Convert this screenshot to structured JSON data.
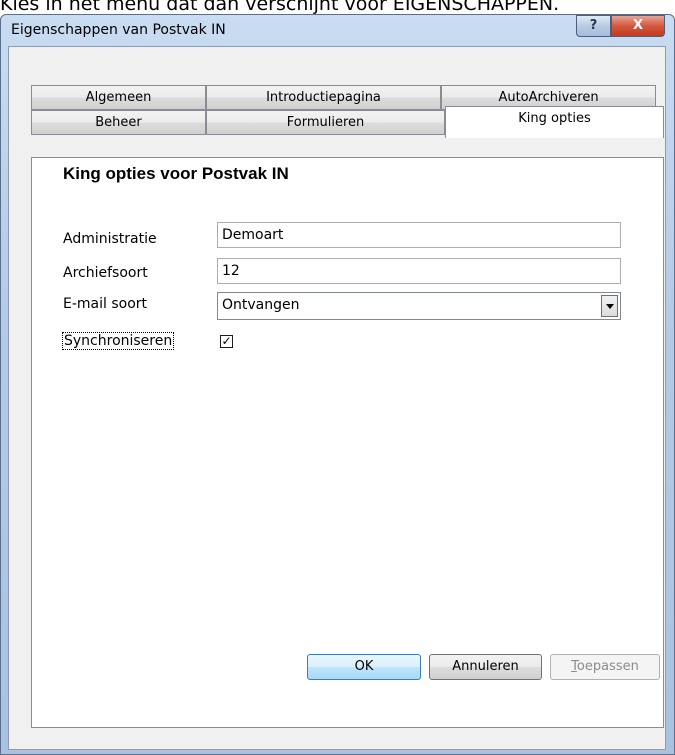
{
  "document_text": "Kies in het menu dat dan verschijnt voor EIGENSCHAPPEN.",
  "window": {
    "title": "Eigenschappen van Postvak IN",
    "help_label": "?",
    "close_label": "X"
  },
  "tabs": {
    "row_back": [
      "Algemeen",
      "Introductiepagina",
      "AutoArchiveren"
    ],
    "row_front": [
      "Beheer",
      "Formulieren",
      "King opties"
    ],
    "active": "King opties"
  },
  "panel": {
    "heading": "King opties voor Postvak IN",
    "administratie_label": "Administratie",
    "administratie_value": "Demoart",
    "archiefsoort_label": "Archiefsoort",
    "archiefsoort_value": "12",
    "email_soort_label": "E-mail soort",
    "email_soort_value": "Ontvangen",
    "synchroniseren_label": "Synchroniseren",
    "synchroniseren_checked": true,
    "check_glyph": "✓"
  },
  "buttons": {
    "ok": "OK",
    "cancel": "Annuleren",
    "apply_first": "T",
    "apply_rest": "oepassen",
    "apply_enabled": false
  }
}
